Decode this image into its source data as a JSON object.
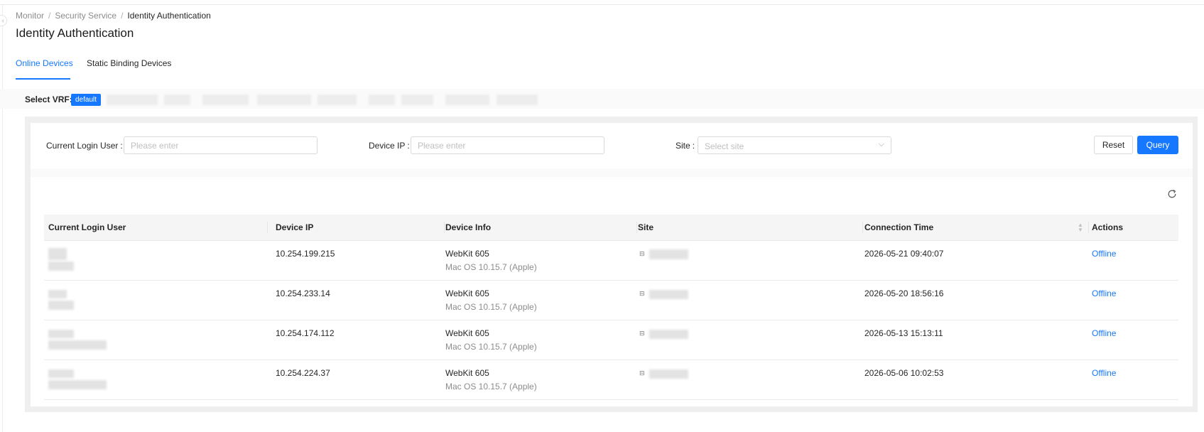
{
  "breadcrumb": {
    "item1": "Monitor",
    "item2": "Security Service",
    "current": "Identity Authentication",
    "separator": "/"
  },
  "page_title": "Identity Authentication",
  "tabs": [
    {
      "label": "Online Devices",
      "active": true
    },
    {
      "label": "Static Binding Devices",
      "active": false
    }
  ],
  "vrf": {
    "label": "Select VRF:",
    "selected": "default"
  },
  "filters": {
    "login_user": {
      "label": "Current Login User",
      "colon": ":",
      "placeholder": "Please enter"
    },
    "device_ip": {
      "label": "Device IP",
      "colon": ":",
      "placeholder": "Please enter"
    },
    "site": {
      "label": "Site",
      "colon": ":",
      "placeholder": "Select site"
    },
    "reset_label": "Reset",
    "query_label": "Query"
  },
  "table": {
    "headers": {
      "user": "Current Login User",
      "ip": "Device IP",
      "info": "Device Info",
      "site": "Site",
      "time": "Connection Time",
      "actions": "Actions"
    },
    "rows": [
      {
        "ip": "10.254.199.215",
        "info_main": "WebKit 605",
        "info_sub": "Mac OS 10.15.7 (Apple)",
        "time": "2026-05-21 09:40:07",
        "action": "Offline"
      },
      {
        "ip": "10.254.233.14",
        "info_main": "WebKit 605",
        "info_sub": "Mac OS 10.15.7 (Apple)",
        "time": "2026-05-20 18:56:16",
        "action": "Offline"
      },
      {
        "ip": "10.254.174.112",
        "info_main": "WebKit 605",
        "info_sub": "Mac OS 10.15.7 (Apple)",
        "time": "2026-05-13 15:13:11",
        "action": "Offline"
      },
      {
        "ip": "10.254.224.37",
        "info_main": "WebKit 605",
        "info_sub": "Mac OS 10.15.7 (Apple)",
        "time": "2026-05-06 10:02:53",
        "action": "Offline"
      }
    ]
  },
  "colors": {
    "primary": "#1677ff",
    "text": "#262626",
    "muted": "#8c8c8c",
    "border": "#d9d9d9"
  },
  "icons": {
    "collapse": "chevron-left-icon",
    "refresh": "refresh-icon",
    "select": "chevron-down-icon",
    "site": "lock-icon",
    "sort": "sort-icon"
  }
}
